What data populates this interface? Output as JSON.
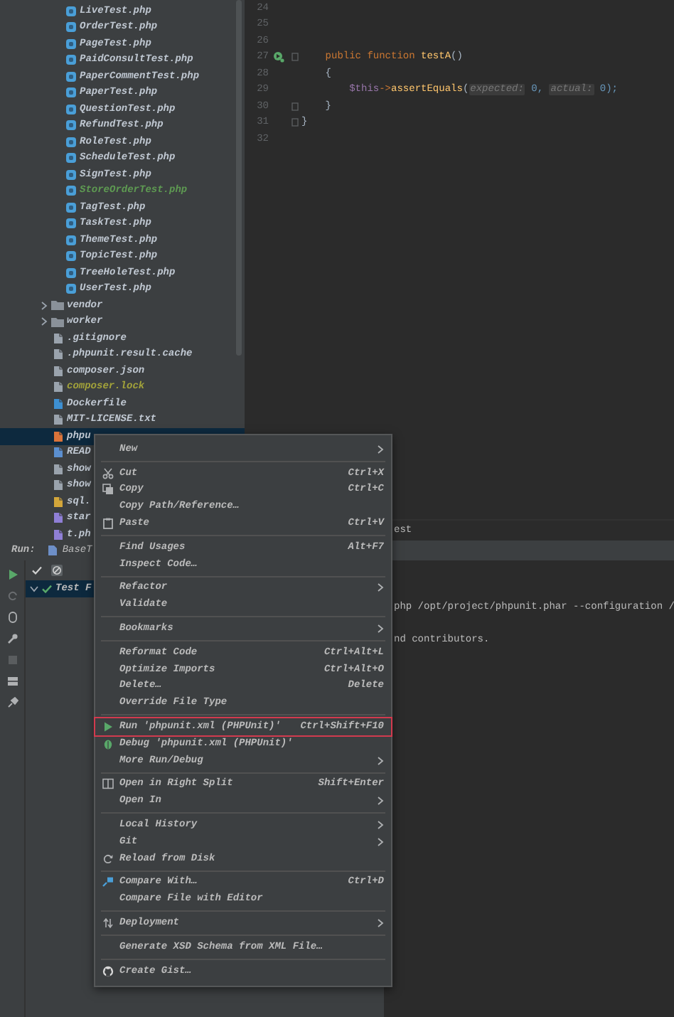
{
  "project_tree": {
    "items": [
      {
        "label": "LiveTest.php",
        "kind": "php",
        "color": "#c0c8d2",
        "selected": false
      },
      {
        "label": "OrderTest.php",
        "kind": "php",
        "color": "#c0c8d2",
        "selected": false
      },
      {
        "label": "PageTest.php",
        "kind": "php",
        "color": "#c0c8d2",
        "selected": false
      },
      {
        "label": "PaidConsultTest.php",
        "kind": "php",
        "color": "#c0c8d2",
        "selected": false
      },
      {
        "label": "PaperCommentTest.php",
        "kind": "php",
        "color": "#c0c8d2",
        "selected": false
      },
      {
        "label": "PaperTest.php",
        "kind": "php",
        "color": "#c0c8d2",
        "selected": false
      },
      {
        "label": "QuestionTest.php",
        "kind": "php",
        "color": "#c0c8d2",
        "selected": false
      },
      {
        "label": "RefundTest.php",
        "kind": "php",
        "color": "#c0c8d2",
        "selected": false
      },
      {
        "label": "RoleTest.php",
        "kind": "php",
        "color": "#c0c8d2",
        "selected": false
      },
      {
        "label": "ScheduleTest.php",
        "kind": "php",
        "color": "#c0c8d2",
        "selected": false
      },
      {
        "label": "SignTest.php",
        "kind": "php",
        "color": "#c0c8d2",
        "selected": false
      },
      {
        "label": "StoreOrderTest.php",
        "kind": "php",
        "color": "#5e9a52",
        "selected": false
      },
      {
        "label": "TagTest.php",
        "kind": "php",
        "color": "#c0c8d2",
        "selected": false
      },
      {
        "label": "TaskTest.php",
        "kind": "php",
        "color": "#c0c8d2",
        "selected": false
      },
      {
        "label": "ThemeTest.php",
        "kind": "php",
        "color": "#c0c8d2",
        "selected": false
      },
      {
        "label": "TopicTest.php",
        "kind": "php",
        "color": "#c0c8d2",
        "selected": false
      },
      {
        "label": "TreeHoleTest.php",
        "kind": "php",
        "color": "#c0c8d2",
        "selected": false
      },
      {
        "label": "UserTest.php",
        "kind": "php",
        "color": "#c0c8d2",
        "selected": false
      },
      {
        "label": "vendor",
        "kind": "folder",
        "expanded": false,
        "color": "#c0c8d2",
        "selected": false
      },
      {
        "label": "worker",
        "kind": "folder",
        "expanded": false,
        "color": "#c0c8d2",
        "selected": false
      },
      {
        "label": ".gitignore",
        "kind": "text",
        "color": "#c0c8d2",
        "selected": false
      },
      {
        "label": ".phpunit.result.cache",
        "kind": "text",
        "color": "#c0c8d2",
        "selected": false
      },
      {
        "label": "composer.json",
        "kind": "text",
        "color": "#c0c8d2",
        "selected": false
      },
      {
        "label": "composer.lock",
        "kind": "text",
        "color": "#a2a23a",
        "selected": false
      },
      {
        "label": "Dockerfile",
        "kind": "docker",
        "color": "#c0c8d2",
        "selected": false
      },
      {
        "label": "MIT-LICENSE.txt",
        "kind": "text",
        "color": "#c0c8d2",
        "selected": false
      },
      {
        "label": "phpu",
        "kind": "xml",
        "color": "#c0c8d2",
        "selected": true
      },
      {
        "label": "READ",
        "kind": "markdown",
        "color": "#c0c8d2",
        "selected": false
      },
      {
        "label": "show",
        "kind": "plain",
        "color": "#c0c8d2",
        "selected": false
      },
      {
        "label": "show",
        "kind": "plain",
        "color": "#c0c8d2",
        "selected": false
      },
      {
        "label": "sql.",
        "kind": "sql",
        "color": "#c0c8d2",
        "selected": false
      },
      {
        "label": "star",
        "kind": "script",
        "color": "#c0c8d2",
        "selected": false
      },
      {
        "label": "t.ph",
        "kind": "script",
        "color": "#c0c8d2",
        "selected": false
      }
    ]
  },
  "editor": {
    "lines": [
      {
        "number": "24"
      },
      {
        "number": "25"
      },
      {
        "number": "26"
      },
      {
        "number": "27",
        "run_marker": true,
        "fold": true,
        "segments": [
          {
            "text": "    public function ",
            "kind": "keyword"
          },
          {
            "text": "testA",
            "kind": "function"
          },
          {
            "text": "()",
            "kind": "plain"
          }
        ]
      },
      {
        "number": "28",
        "segments": [
          {
            "text": "    {",
            "kind": "plain"
          }
        ]
      },
      {
        "number": "29",
        "segments": [
          {
            "text": "        $this",
            "kind": "variable"
          },
          {
            "text": "->",
            "kind": "keyword"
          },
          {
            "text": "assertEquals",
            "kind": "function"
          },
          {
            "text": "(",
            "kind": "plain"
          },
          {
            "text": "expected:",
            "kind": "hint"
          },
          {
            "text": " 0, ",
            "kind": "number"
          },
          {
            "text": "actual:",
            "kind": "hint"
          },
          {
            "text": " 0);",
            "kind": "number"
          }
        ]
      },
      {
        "number": "30",
        "fold": true,
        "segments": [
          {
            "text": "    }",
            "kind": "plain"
          }
        ]
      },
      {
        "number": "31",
        "fold": true,
        "segments": [
          {
            "text": "}",
            "kind": "plain"
          }
        ]
      },
      {
        "number": "32"
      }
    ],
    "tab_fragment": "est"
  },
  "context_menu": {
    "items": [
      {
        "kind": "item",
        "label": "New",
        "submenu": true,
        "highlighted": false
      },
      {
        "kind": "separator"
      },
      {
        "kind": "item",
        "label": "Cut",
        "shortcut": "Ctrl+X",
        "submenu": false,
        "highlighted": false
      },
      {
        "kind": "item",
        "label": "Copy",
        "shortcut": "Ctrl+C",
        "submenu": false,
        "highlighted": false
      },
      {
        "kind": "item",
        "label": "Copy Path/Reference…",
        "submenu": false,
        "highlighted": false
      },
      {
        "kind": "item",
        "label": "Paste",
        "shortcut": "Ctrl+V",
        "submenu": false,
        "highlighted": false
      },
      {
        "kind": "separator"
      },
      {
        "kind": "item",
        "label": "Find Usages",
        "shortcut": "Alt+F7",
        "submenu": false,
        "highlighted": false
      },
      {
        "kind": "item",
        "label": "Inspect Code…",
        "submenu": false,
        "highlighted": false
      },
      {
        "kind": "separator"
      },
      {
        "kind": "item",
        "label": "Refactor",
        "submenu": true,
        "highlighted": false
      },
      {
        "kind": "item",
        "label": "Validate",
        "submenu": false,
        "highlighted": false
      },
      {
        "kind": "separator"
      },
      {
        "kind": "item",
        "label": "Bookmarks",
        "submenu": true,
        "highlighted": false
      },
      {
        "kind": "separator"
      },
      {
        "kind": "item",
        "label": "Reformat Code",
        "shortcut": "Ctrl+Alt+L",
        "submenu": false,
        "highlighted": false
      },
      {
        "kind": "item",
        "label": "Optimize Imports",
        "shortcut": "Ctrl+Alt+O",
        "submenu": false,
        "highlighted": false
      },
      {
        "kind": "item",
        "label": "Delete…",
        "shortcut": "Delete",
        "submenu": false,
        "highlighted": false
      },
      {
        "kind": "item",
        "label": "Override File Type",
        "submenu": false,
        "highlighted": false
      },
      {
        "kind": "separator"
      },
      {
        "kind": "item",
        "label": "Run 'phpunit.xml (PHPUnit)'",
        "shortcut": "Ctrl+Shift+F10",
        "submenu": false,
        "highlighted": true
      },
      {
        "kind": "item",
        "label": "Debug 'phpunit.xml (PHPUnit)'",
        "submenu": false,
        "highlighted": false
      },
      {
        "kind": "item",
        "label": "More Run/Debug",
        "submenu": true,
        "highlighted": false
      },
      {
        "kind": "separator"
      },
      {
        "kind": "item",
        "label": "Open in Right Split",
        "shortcut": "Shift+Enter",
        "submenu": false,
        "highlighted": false
      },
      {
        "kind": "item",
        "label": "Open In",
        "submenu": true,
        "highlighted": false
      },
      {
        "kind": "separator"
      },
      {
        "kind": "item",
        "label": "Local History",
        "submenu": true,
        "highlighted": false
      },
      {
        "kind": "item",
        "label": "Git",
        "submenu": true,
        "highlighted": false
      },
      {
        "kind": "item",
        "label": "Reload from Disk",
        "submenu": false,
        "highlighted": false
      },
      {
        "kind": "separator"
      },
      {
        "kind": "item",
        "label": "Compare With…",
        "shortcut": "Ctrl+D",
        "submenu": false,
        "highlighted": false
      },
      {
        "kind": "item",
        "label": "Compare File with Editor",
        "submenu": false,
        "highlighted": false
      },
      {
        "kind": "separator"
      },
      {
        "kind": "item",
        "label": "Deployment",
        "submenu": true,
        "highlighted": false
      },
      {
        "kind": "separator"
      },
      {
        "kind": "item",
        "label": "Generate XSD Schema from XML File…",
        "submenu": false,
        "highlighted": false
      },
      {
        "kind": "separator"
      },
      {
        "kind": "item",
        "label": "Create Gist…",
        "submenu": false,
        "highlighted": false
      }
    ]
  },
  "run_panel": {
    "label": "Run:",
    "tab": "BaseT",
    "tests": [
      {
        "label": "Test F",
        "passed": true,
        "expanded": true,
        "selected": true
      }
    ],
    "console_lines": [
      "php /opt/project/phpunit.phar --configuration /",
      "nd contributors."
    ]
  }
}
